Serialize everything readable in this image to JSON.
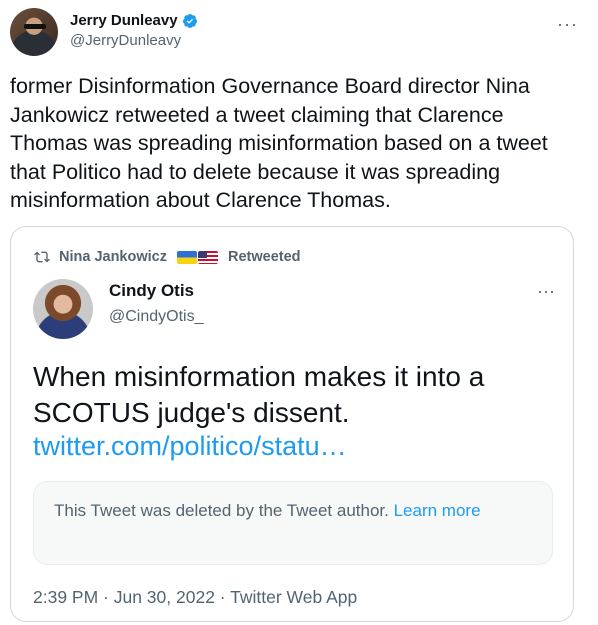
{
  "author": {
    "name": "Jerry Dunleavy",
    "handle": "@JerryDunleavy",
    "more": "···"
  },
  "tweet_text": "former Disinformation Governance Board director Nina Jankowicz retweeted a tweet claiming that Clarence Thomas was spreading misinformation based on a tweet that Politico had to delete because it was spreading misinformation about Clarence Thomas.",
  "embedded": {
    "retweeted_by": "Nina Jankowicz",
    "retweeted_label": "Retweeted",
    "name": "Cindy Otis",
    "handle": "@CindyOtis_",
    "more": "···",
    "text": "When misinformation makes it into a SCOTUS judge's dissent.",
    "link": "twitter.com/politico/statu…",
    "deleted_notice": "This Tweet was deleted by the Tweet author.",
    "learn_more": "Learn more",
    "timestamp": "2:39 PM · Jun 30, 2022 · Twitter Web App"
  },
  "colors": {
    "accent": "#1d9bf0",
    "muted": "#536471",
    "text": "#0f1419"
  },
  "icons": [
    "verified-badge-icon",
    "more-icon",
    "retweet-icon",
    "ukraine-flag-icon",
    "us-flag-icon"
  ]
}
